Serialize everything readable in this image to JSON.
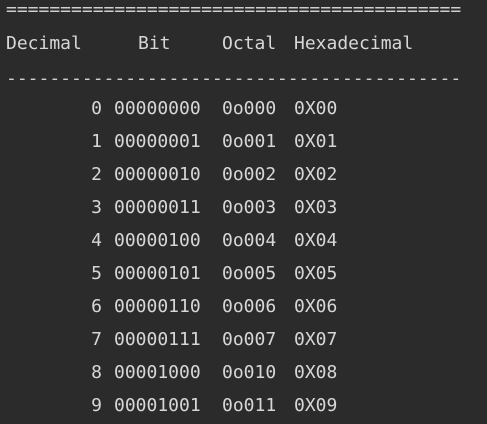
{
  "console": {
    "separator_top": "==========================================",
    "headers": [
      "Decimal",
      "Bit",
      "Octal",
      "Hexadecimal"
    ],
    "separator_mid": "------------------------------------------",
    "rows": [
      {
        "decimal": "0",
        "bit": "00000000",
        "octal": "0o000",
        "hex": "0X00"
      },
      {
        "decimal": "1",
        "bit": "00000001",
        "octal": "0o001",
        "hex": "0X01"
      },
      {
        "decimal": "2",
        "bit": "00000010",
        "octal": "0o002",
        "hex": "0X02"
      },
      {
        "decimal": "3",
        "bit": "00000011",
        "octal": "0o003",
        "hex": "0X03"
      },
      {
        "decimal": "4",
        "bit": "00000100",
        "octal": "0o004",
        "hex": "0X04"
      },
      {
        "decimal": "5",
        "bit": "00000101",
        "octal": "0o005",
        "hex": "0X05"
      },
      {
        "decimal": "6",
        "bit": "00000110",
        "octal": "0o006",
        "hex": "0X06"
      },
      {
        "decimal": "7",
        "bit": "00000111",
        "octal": "0o007",
        "hex": "0X07"
      },
      {
        "decimal": "8",
        "bit": "00001000",
        "octal": "0o010",
        "hex": "0X08"
      },
      {
        "decimal": "9",
        "bit": "00001001",
        "octal": "0o011",
        "hex": "0X09"
      }
    ]
  },
  "colors": {
    "background": "#2b2b2b",
    "text": "#d7d7d7"
  }
}
